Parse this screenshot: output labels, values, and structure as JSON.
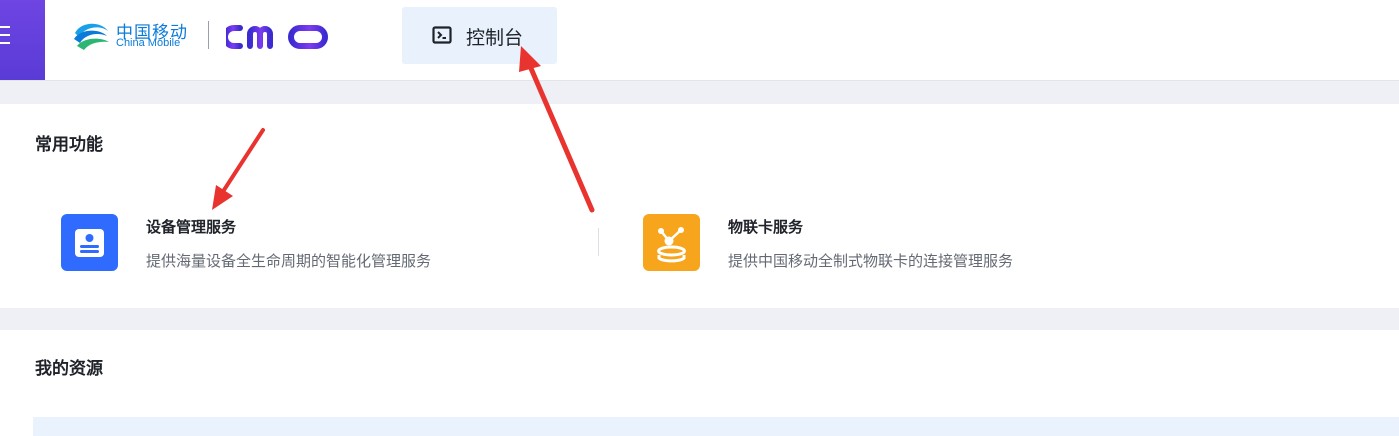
{
  "header": {
    "brand_cn": "中国移动",
    "brand_en": "China Mobile",
    "product_logo": "CMIOT",
    "console_tab_label": "控制台"
  },
  "common_functions": {
    "title": "常用功能",
    "services": [
      {
        "name": "设备管理服务",
        "desc": "提供海量设备全生命周期的智能化管理服务",
        "icon": "device-management-icon",
        "color": "#2f6bff"
      },
      {
        "name": "物联卡服务",
        "desc": "提供中国移动全制式物联卡的连接管理服务",
        "icon": "iot-card-icon",
        "color": "#f7a51c"
      }
    ]
  },
  "my_resources": {
    "title": "我的资源"
  },
  "colors": {
    "menu_purple": "#6e45e2",
    "accent_blue": "#2f6bff",
    "accent_orange": "#f7a51c",
    "annotation_red": "#e8332f",
    "brand_blue": "#0a7bd8"
  }
}
